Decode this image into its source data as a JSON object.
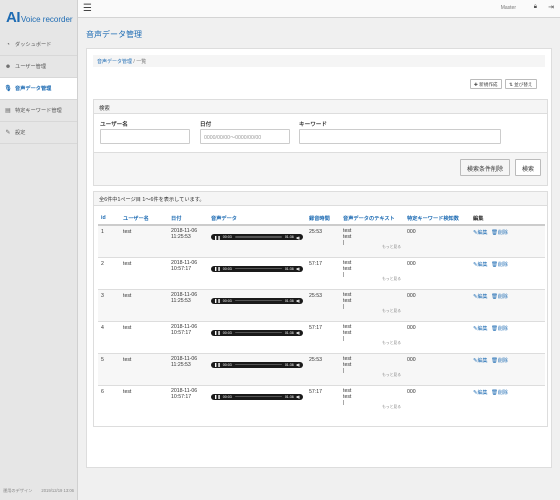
{
  "app": {
    "logo_main": "AI",
    "logo_sub": "Voice recorder"
  },
  "sidebar": {
    "items": [
      {
        "label": "ダッシュボード",
        "icon": "dashboard-icon",
        "glyph": "◔"
      },
      {
        "label": "ユーザー管理",
        "icon": "users-icon",
        "glyph": "☻"
      },
      {
        "label": "音声データ管理",
        "icon": "microphone-icon",
        "glyph": "🎙︎"
      },
      {
        "label": "特定キーワード管理",
        "icon": "document-icon",
        "glyph": "▤"
      },
      {
        "label": "設定",
        "icon": "wrench-icon",
        "glyph": "✎"
      }
    ],
    "footer_left": "運用のデザイン",
    "footer_right": "2019/12/19 13:06"
  },
  "topbar": {
    "menu_glyph": "☰",
    "user": "Master",
    "lock_glyph": "🔒︎",
    "logout_glyph": "⇥"
  },
  "page": {
    "title": "音声データ管理",
    "breadcrumb_link": "音声データ管理",
    "breadcrumb_sep": "/",
    "breadcrumb_current": "一覧",
    "new_button": "新規作成",
    "sort_button": "並び替え"
  },
  "search": {
    "heading": "検索",
    "user_label": "ユーザー名",
    "user_value": "",
    "date_label": "日付",
    "date_placeholder": "0000/00/00〜0000/00/00",
    "keyword_label": "キーワード",
    "keyword_value": "",
    "clear_button": "検索条件削除",
    "search_button": "検索"
  },
  "list": {
    "summary": "全6件中1ページ目 1〜6件を表示しています。",
    "columns": [
      "id",
      "ユーザー名",
      "日付",
      "音声データ",
      "録音時間",
      "音声データのテキスト",
      "特定キーワード検知数",
      "編集"
    ],
    "edit_label": "編集",
    "delete_label": "削除",
    "more_label": "もっと見る",
    "rows": [
      {
        "id": "1",
        "user": "test",
        "date": "2018-11-06",
        "time": "11:25:53",
        "pos": "00:03",
        "len": "01:36",
        "duration": "25:53",
        "text1": "test",
        "text2": "test",
        "text3": "|",
        "count": "000"
      },
      {
        "id": "2",
        "user": "test",
        "date": "2018-11-06",
        "time": "10:57:17",
        "pos": "00:03",
        "len": "01:36",
        "duration": "57:17",
        "text1": "test",
        "text2": "test",
        "text3": "|",
        "count": "000"
      },
      {
        "id": "3",
        "user": "test",
        "date": "2018-11-06",
        "time": "11:25:53",
        "pos": "00:03",
        "len": "01:36",
        "duration": "25:53",
        "text1": "test",
        "text2": "test",
        "text3": "|",
        "count": "000"
      },
      {
        "id": "4",
        "user": "test",
        "date": "2018-11-06",
        "time": "10:57:17",
        "pos": "00:03",
        "len": "01:36",
        "duration": "57:17",
        "text1": "test",
        "text2": "test",
        "text3": "|",
        "count": "000"
      },
      {
        "id": "5",
        "user": "test",
        "date": "2018-11-06",
        "time": "11:25:53",
        "pos": "00:03",
        "len": "01:36",
        "duration": "25:53",
        "text1": "test",
        "text2": "test",
        "text3": "|",
        "count": "000"
      },
      {
        "id": "6",
        "user": "test",
        "date": "2018-11-06",
        "time": "10:57:17",
        "pos": "00:03",
        "len": "01:36",
        "duration": "57:17",
        "text1": "test",
        "text2": "test",
        "text3": "|",
        "count": "000"
      }
    ]
  },
  "colors": {
    "accent": "#1d6bb3",
    "sidebar_bg": "#e6e6e6",
    "player_bg": "#1a1a1a"
  }
}
